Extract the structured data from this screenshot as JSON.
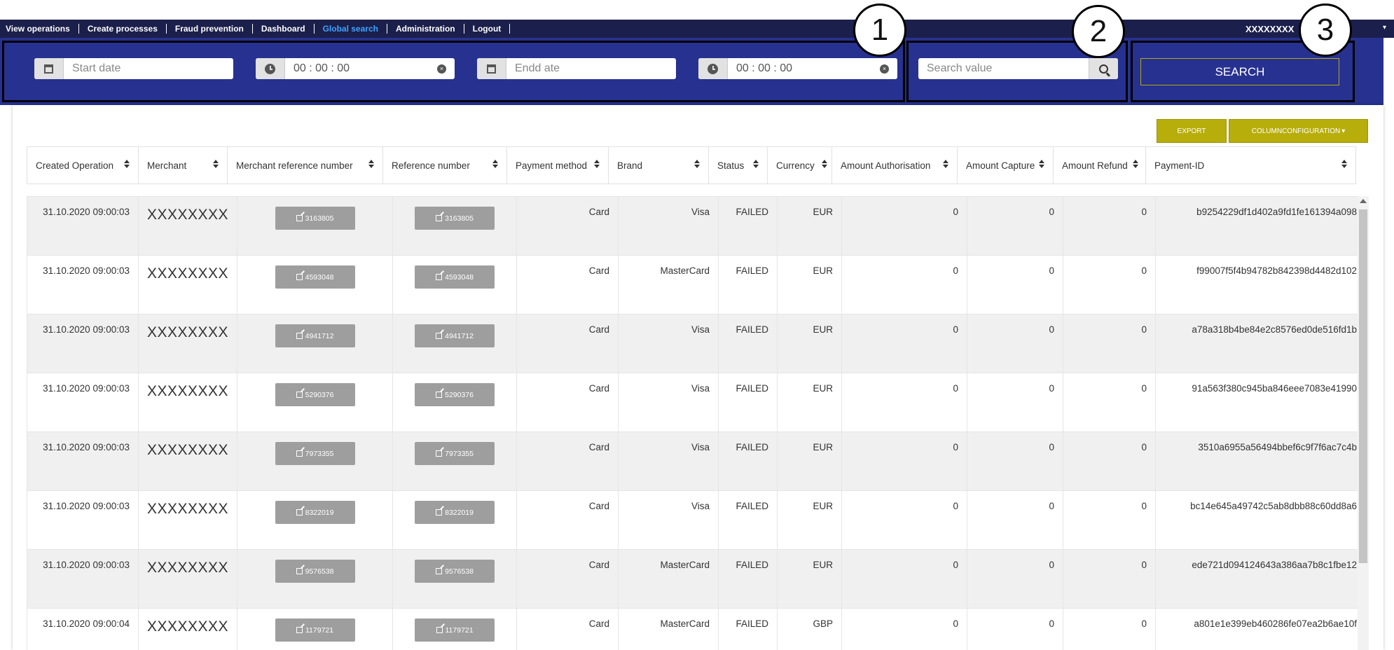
{
  "nav": {
    "items": [
      "View operations",
      "Create processes",
      "Fraud prevention",
      "Dashboard",
      "Global search",
      "Administration",
      "Logout"
    ],
    "active": "Global search",
    "user": "XXXXXXXX"
  },
  "filters": {
    "start_date_placeholder": "Start date",
    "start_time": "00 : 00 : 00",
    "end_date_placeholder": "Endd ate",
    "end_time": "00 : 00 : 00",
    "search_placeholder": "Search value",
    "search_button": "SEARCH"
  },
  "callouts": [
    "1",
    "2",
    "3"
  ],
  "toolbar": {
    "export": "EXPORT",
    "column_config": "COLUMNCONFIGURATION"
  },
  "columns": [
    "Created Operation",
    "Merchant",
    "Merchant reference number",
    "Reference number",
    "Payment method",
    "Brand",
    "Status",
    "Currency",
    "Amount Authorisation",
    "Amount Capture",
    "Amount Refund",
    "Payment-ID"
  ],
  "rows": [
    {
      "created": "31.10.2020 09:00:03",
      "merchant": "XXXXXXXX",
      "merchant_ref": "3163805",
      "ref": "3163805",
      "method": "Card",
      "brand": "Visa",
      "status": "FAILED",
      "currency": "EUR",
      "auth": "0",
      "capture": "0",
      "refund": "0",
      "payment_id": "b9254229df1d402a9fd1fe161394a098"
    },
    {
      "created": "31.10.2020 09:00:03",
      "merchant": "XXXXXXXX",
      "merchant_ref": "4593048",
      "ref": "4593048",
      "method": "Card",
      "brand": "MasterCard",
      "status": "FAILED",
      "currency": "EUR",
      "auth": "0",
      "capture": "0",
      "refund": "0",
      "payment_id": "f99007f5f4b94782b842398d4482d102"
    },
    {
      "created": "31.10.2020 09:00:03",
      "merchant": "XXXXXXXX",
      "merchant_ref": "4941712",
      "ref": "4941712",
      "method": "Card",
      "brand": "Visa",
      "status": "FAILED",
      "currency": "EUR",
      "auth": "0",
      "capture": "0",
      "refund": "0",
      "payment_id": "a78a318b4be84e2c8576ed0de516fd1b"
    },
    {
      "created": "31.10.2020 09:00:03",
      "merchant": "XXXXXXXX",
      "merchant_ref": "5290376",
      "ref": "5290376",
      "method": "Card",
      "brand": "Visa",
      "status": "FAILED",
      "currency": "EUR",
      "auth": "0",
      "capture": "0",
      "refund": "0",
      "payment_id": "91a563f380c945ba846eee7083e41990"
    },
    {
      "created": "31.10.2020 09:00:03",
      "merchant": "XXXXXXXX",
      "merchant_ref": "7973355",
      "ref": "7973355",
      "method": "Card",
      "brand": "Visa",
      "status": "FAILED",
      "currency": "EUR",
      "auth": "0",
      "capture": "0",
      "refund": "0",
      "payment_id": "3510a6955a56494bbef6c9f7f6ac7c4b"
    },
    {
      "created": "31.10.2020 09:00:03",
      "merchant": "XXXXXXXX",
      "merchant_ref": "8322019",
      "ref": "8322019",
      "method": "Card",
      "brand": "Visa",
      "status": "FAILED",
      "currency": "EUR",
      "auth": "0",
      "capture": "0",
      "refund": "0",
      "payment_id": "bc14e645a49742c5ab8dbb88c60dd8a6"
    },
    {
      "created": "31.10.2020 09:00:03",
      "merchant": "XXXXXXXX",
      "merchant_ref": "9576538",
      "ref": "9576538",
      "method": "Card",
      "brand": "MasterCard",
      "status": "FAILED",
      "currency": "EUR",
      "auth": "0",
      "capture": "0",
      "refund": "0",
      "payment_id": "ede721d094124643a386aa7b8c1fbe12"
    },
    {
      "created": "31.10.2020 09:00:04",
      "merchant": "XXXXXXXX",
      "merchant_ref": "1179721",
      "ref": "1179721",
      "method": "Card",
      "brand": "MasterCard",
      "status": "FAILED",
      "currency": "GBP",
      "auth": "0",
      "capture": "0",
      "refund": "0",
      "payment_id": "a801e1e399eb460286fe07ea2b6ae10f"
    }
  ],
  "colors": {
    "nav_bg": "#1b1f4b",
    "filter_bg": "#27318f",
    "accent_olive": "#b7ae0c",
    "active_link": "#3ea2ff"
  }
}
